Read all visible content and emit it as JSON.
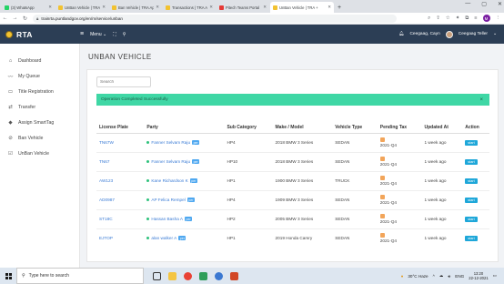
{
  "browser": {
    "tabs": [
      {
        "label": "(3) WhatsApp",
        "color": "#25d366",
        "active": false
      },
      {
        "label": "UnBan Vehicle | TRA +",
        "color": "#f2c230",
        "active": false
      },
      {
        "label": "Ban Vehicle | TRA App",
        "color": "#f2c230",
        "active": false
      },
      {
        "label": "Transactions | TRA Ap",
        "color": "#f2c230",
        "active": false
      },
      {
        "label": "Pitech Teams Portal",
        "color": "#e53935",
        "active": false
      },
      {
        "label": "UnBan Vehicle | TRA +",
        "color": "#f2c230",
        "active": true
      }
    ],
    "new_tab": "+",
    "url": "trainrta.puntlandgov.org/en/m/service/unban",
    "profile_initial": "M"
  },
  "header": {
    "brand": "RTA",
    "menu_label": "Menu",
    "user_name": "Ceegaag, Cayn",
    "user_role": "Ceegaag Teller"
  },
  "sidebar": {
    "items": [
      {
        "label": "Dashboard",
        "icon": "home-icon",
        "glyph": "⌂"
      },
      {
        "label": "My Queue",
        "icon": "activity-icon",
        "glyph": "〰"
      },
      {
        "label": "Title Registration",
        "icon": "document-icon",
        "glyph": "▭"
      },
      {
        "label": "Transfer",
        "icon": "transfer-icon",
        "glyph": "⇄"
      },
      {
        "label": "Assign SmartTag",
        "icon": "tag-icon",
        "glyph": "◆"
      },
      {
        "label": "Ban Vehicle",
        "icon": "ban-icon",
        "glyph": "⊘"
      },
      {
        "label": "UnBan Vehicle",
        "icon": "check-square-icon",
        "glyph": "☑"
      }
    ]
  },
  "main": {
    "title": "UNBAN VEHICLE",
    "search_placeholder": "Search",
    "alert": "Operation Completed Successfully",
    "alert_close": "×",
    "columns": [
      "License Plate",
      "Party",
      "Sub Category",
      "Make / Model",
      "Vehicle Type",
      "Pending Tax",
      "Updated At",
      "Action"
    ],
    "rows": [
      {
        "plate": "TN67W",
        "party": "Fanner Selvam Raju",
        "badge": "per",
        "sub": "HP4",
        "model": "2018 BMW 3 Series",
        "type": "SEDAN",
        "tax": "2021-Q4",
        "updated": "1 week ago",
        "action": "start"
      },
      {
        "plate": "TN67",
        "party": "Fanner Selvam Raju",
        "badge": "per",
        "sub": "HP10",
        "model": "2018 BMW 3 Series",
        "type": "SEDAN",
        "tax": "2021-Q4",
        "updated": "1 week ago",
        "action": "start"
      },
      {
        "plate": "AW123",
        "party": "Kane Richardson K",
        "badge": "per",
        "sub": "HP1",
        "model": "1900 BMW 3 Series",
        "type": "TRUCK",
        "tax": "2021-Q4",
        "updated": "1 week ago",
        "action": "start"
      },
      {
        "plate": "AD0987",
        "party": "AP Felica Rempel",
        "badge": "per",
        "sub": "HP4",
        "model": "1909 BMW 3 Series",
        "type": "SEDAN",
        "tax": "2021-Q4",
        "updated": "1 week ago",
        "action": "start"
      },
      {
        "plate": "ST18C",
        "party": "Hassan Basha A",
        "badge": "per",
        "sub": "HP2",
        "model": "2005 BMW 3 Series",
        "type": "SEDAN",
        "tax": "2021-Q4",
        "updated": "1 week ago",
        "action": "start"
      },
      {
        "plate": "EJTOP",
        "party": "alan walker A",
        "badge": "per",
        "sub": "HP1",
        "model": "2019 Honda Camry",
        "type": "SEDAN",
        "tax": "2021-Q4",
        "updated": "1 week ago",
        "action": "start"
      }
    ]
  },
  "taskbar": {
    "search_placeholder": "Type here to search",
    "weather": "30°C  Haze",
    "lang": "ENG",
    "time": "13:20",
    "date": "22-12-2021"
  }
}
